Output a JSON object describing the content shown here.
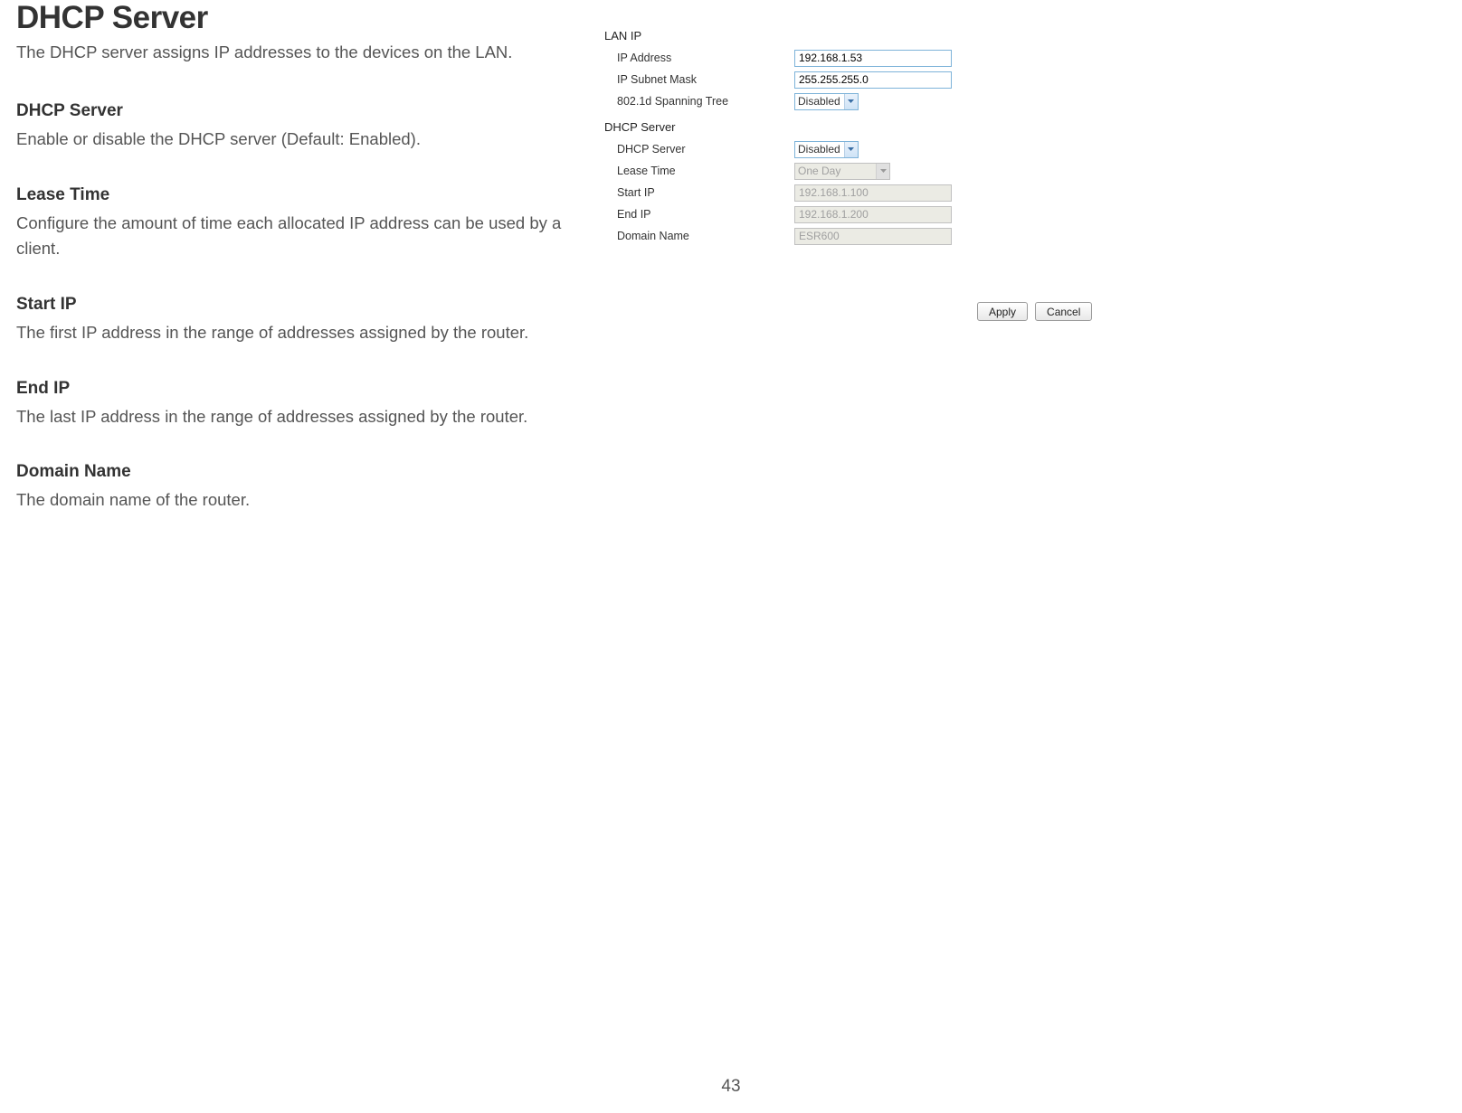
{
  "page_title": "DHCP Server",
  "page_subtitle": "The DHCP server assigns IP addresses to the devices on the LAN.",
  "definitions": [
    {
      "title": "DHCP Server",
      "desc": "Enable or disable the DHCP server (Default: Enabled)."
    },
    {
      "title": "Lease Time",
      "desc": "Configure the amount of time each allocated IP address can be used by a client."
    },
    {
      "title": "Start IP",
      "desc": "The first IP address in the range of addresses assigned by the router."
    },
    {
      "title": "End IP",
      "desc": "The last IP address in the range of addresses assigned by the router."
    },
    {
      "title": "Domain Name",
      "desc": "The domain name of the router."
    }
  ],
  "lan_ip": {
    "section": "LAN IP",
    "ip_address_label": "IP Address",
    "ip_address_value": "192.168.1.53",
    "subnet_label": "IP Subnet Mask",
    "subnet_value": "255.255.255.0",
    "spanning_label": "802.1d Spanning Tree",
    "spanning_value": "Disabled"
  },
  "dhcp": {
    "section": "DHCP Server",
    "server_label": "DHCP Server",
    "server_value": "Disabled",
    "lease_label": "Lease Time",
    "lease_value": "One Day",
    "start_label": "Start IP",
    "start_value": "192.168.1.100",
    "end_label": "End IP",
    "end_value": "192.168.1.200",
    "domain_label": "Domain Name",
    "domain_value": "ESR600"
  },
  "buttons": {
    "apply": "Apply",
    "cancel": "Cancel"
  },
  "page_number": "43"
}
